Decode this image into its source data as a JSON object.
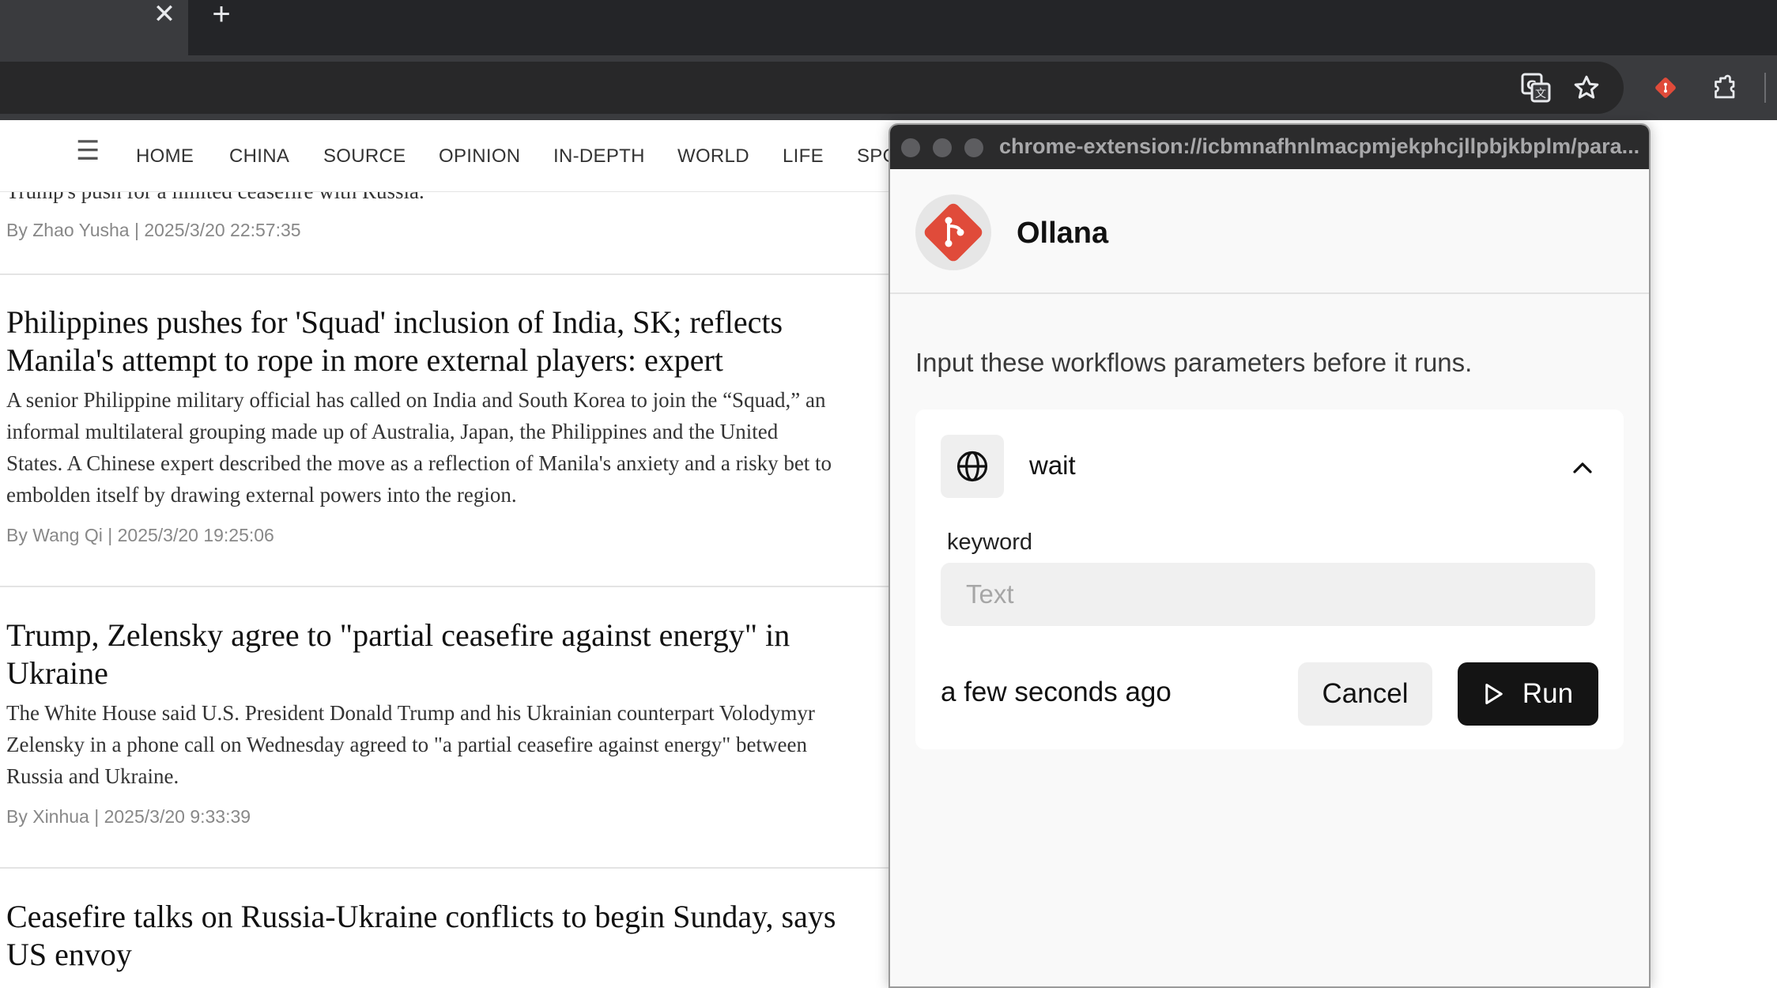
{
  "browser": {
    "tab_close_glyph": "✕",
    "new_tab_glyph": "+",
    "toolbar_icons": [
      "translate-icon",
      "bookmark-star-icon",
      "git-extension-icon",
      "extensions-puzzle-icon"
    ]
  },
  "site": {
    "nav": [
      "HOME",
      "CHINA",
      "SOURCE",
      "OPINION",
      "IN-DEPTH",
      "WORLD",
      "LIFE",
      "SPO"
    ],
    "partial_top_text": "Trump's push for a limited ceasefire with Russia.",
    "top_meta": "By Zhao Yusha | 2025/3/20 22:57:35",
    "articles": [
      {
        "title_lines": [
          "Philippines pushes for 'Squad' inclusion of India, SK; reflects",
          "Manila's attempt to rope in more external players: expert"
        ],
        "summary_lines": [
          "A senior Philippine military official has called on India and South Korea to join the “Squad,” an",
          "informal multilateral grouping made up of Australia, Japan, the Philippines and the United",
          "States. A Chinese expert described the move as a reflection of Manila's anxiety and a risky bet to",
          "embolden itself by drawing external powers into the region."
        ],
        "meta": "By Wang Qi | 2025/3/20 19:25:06"
      },
      {
        "title_lines": [
          "Trump, Zelensky agree to \"partial ceasefire against energy\" in",
          "Ukraine"
        ],
        "summary_lines": [
          "The White House said U.S. President Donald Trump and his Ukrainian counterpart Volodymyr",
          "Zelensky in a phone call on Wednesday agreed to \"a partial ceasefire against energy\" between",
          "Russia and Ukraine."
        ],
        "meta": "By Xinhua | 2025/3/20 9:33:39"
      },
      {
        "title_lines": [
          "Ceasefire talks on Russia-Ukraine conflicts to begin Sunday, says",
          "US envoy"
        ]
      }
    ]
  },
  "popup": {
    "url": "chrome-extension://icbmnafhnlmacpmjekphcjllpbjkbplm/para...",
    "ext_name": "Ollana",
    "prompt": "Input these workflows parameters before it runs.",
    "workflow": {
      "name": "wait",
      "field_label": "keyword",
      "field_value": "",
      "field_placeholder": "Text"
    },
    "time": "a few seconds ago",
    "cancel_label": "Cancel",
    "run_label": "Run",
    "colors": {
      "logo_red": "#e04b3a",
      "run_bg": "#141414"
    }
  }
}
